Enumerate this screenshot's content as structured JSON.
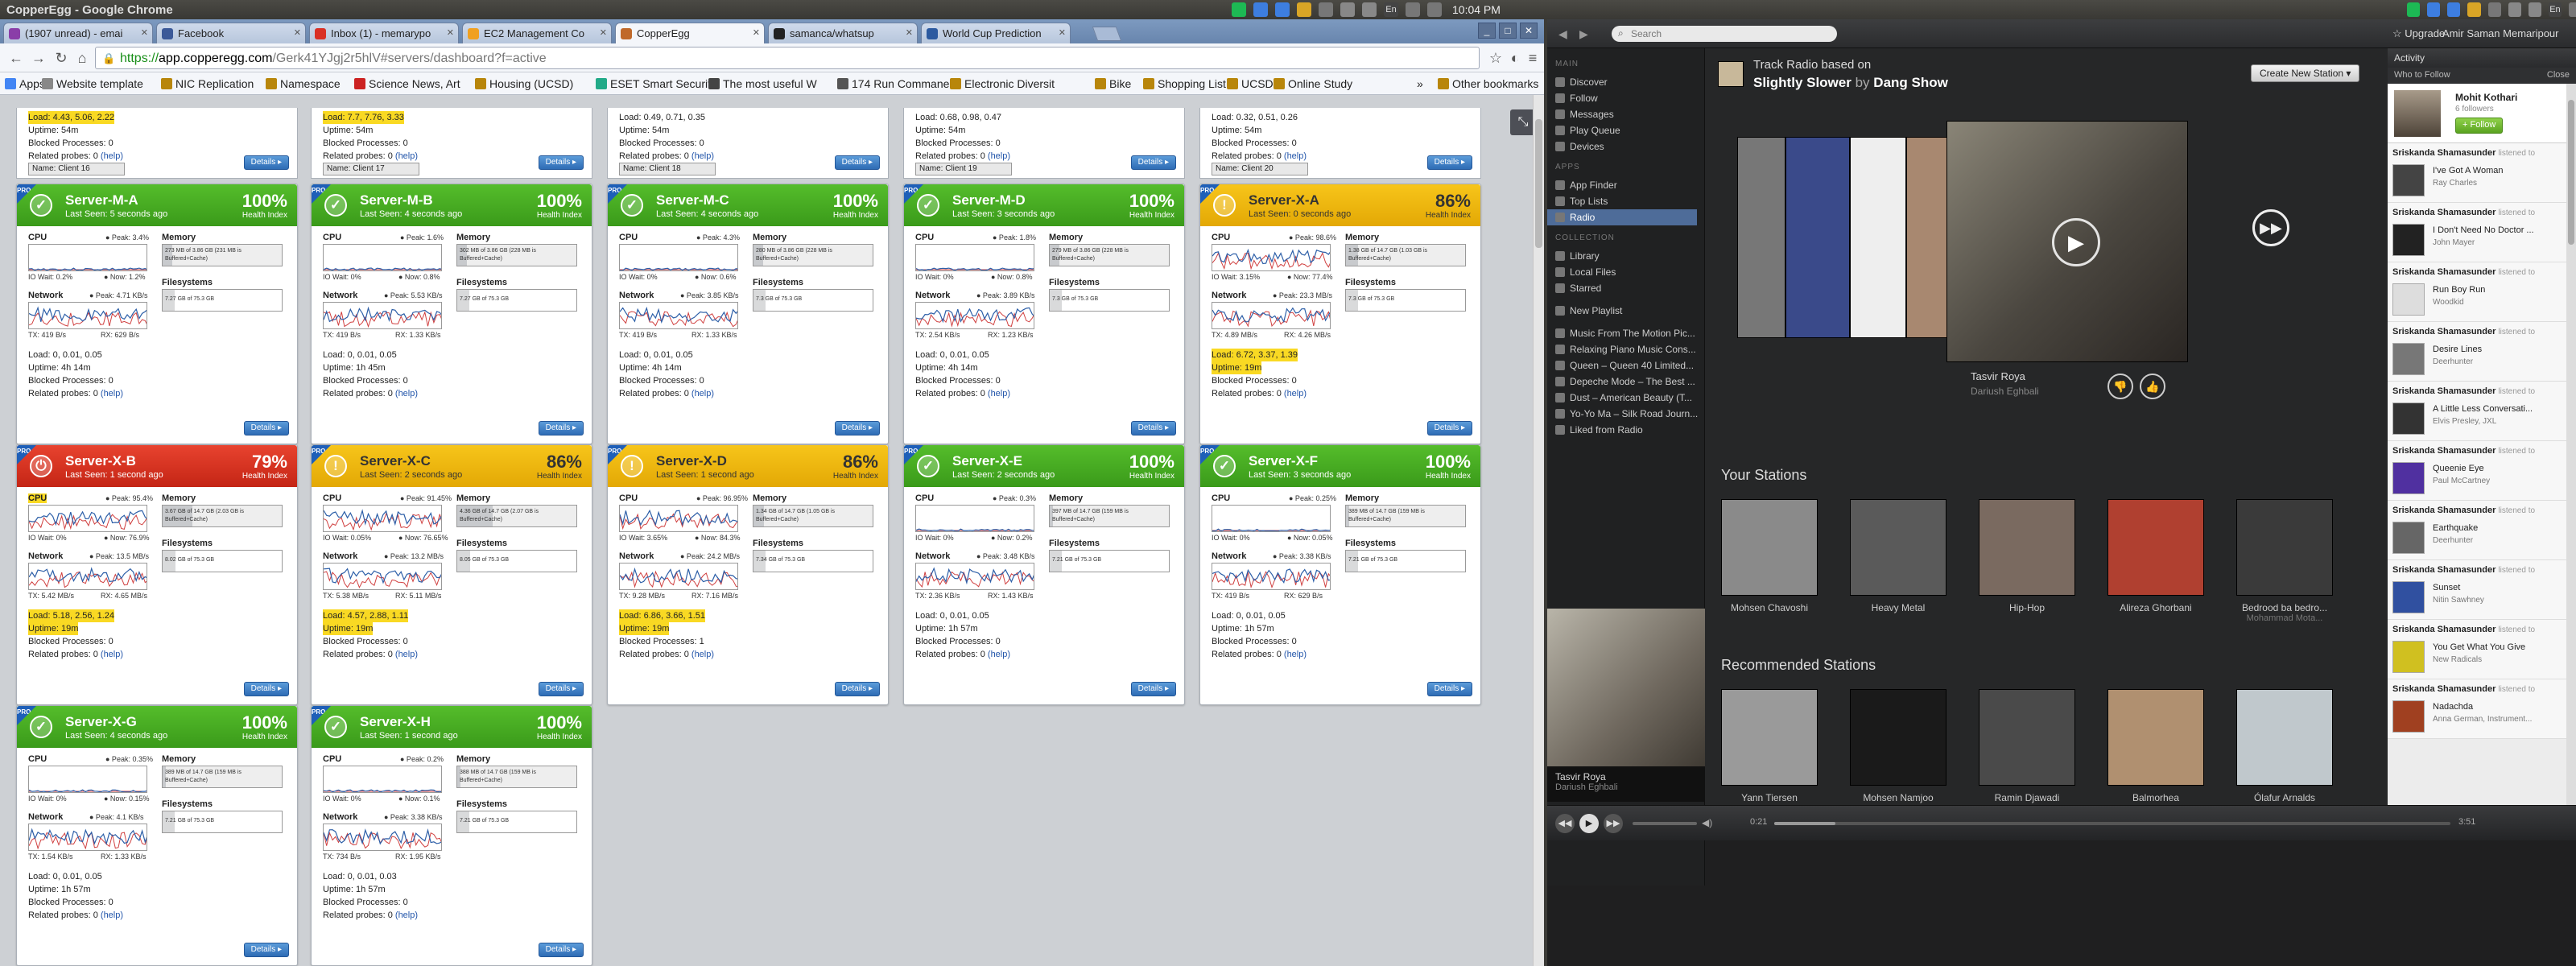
{
  "system": {
    "window_title": "CopperEgg - Google Chrome",
    "clock_left": "10:04 PM",
    "clock_right": "10:04 PM",
    "tray_left": [
      "spotify-icon",
      "dropbox-icon",
      "dropbox-icon",
      "chrome-icon",
      "network-icon",
      "mail-icon",
      "bluetooth-icon",
      "keyboard-en-icon",
      "battery-icon",
      "volume-icon"
    ],
    "tray_right": [
      "spotify-icon",
      "dropbox-icon",
      "dropbox-icon",
      "chrome-icon",
      "network-icon",
      "mail-icon",
      "bluetooth-icon",
      "keyboard-en-icon",
      "battery-icon",
      "volume-icon"
    ],
    "keyboard_label": "En"
  },
  "chrome": {
    "tabs": [
      {
        "label": "(1907 unread) - emai",
        "color": "#8a3ea8"
      },
      {
        "label": "Facebook",
        "color": "#3b5998"
      },
      {
        "label": "Inbox (1) - memarypo",
        "color": "#d93025"
      },
      {
        "label": "EC2 Management Co",
        "color": "#f0a020"
      },
      {
        "label": "CopperEgg",
        "color": "#c0692a"
      },
      {
        "label": "samanca/whatsup",
        "color": "#222222"
      },
      {
        "label": "World Cup Prediction",
        "color": "#2c5aa0"
      }
    ],
    "active_tab": 4,
    "url_scheme": "https",
    "url_host": "app.copperegg.com",
    "url_path": "/Gerk41YJgj2r5hlV#servers/dashboard?f=active",
    "bookmarks": [
      {
        "label": "Apps",
        "color": "#4285f4"
      },
      {
        "label": "Website template",
        "color": "#888888"
      },
      {
        "label": "NIC Replication",
        "color": "#b8860b"
      },
      {
        "label": "Namespace",
        "color": "#b8860b"
      },
      {
        "label": "Science News, Art",
        "color": "#cc2222"
      },
      {
        "label": "Housing (UCSD)",
        "color": "#b8860b"
      },
      {
        "label": "ESET Smart Securit",
        "color": "#22aa88"
      },
      {
        "label": "The most useful W",
        "color": "#444444"
      },
      {
        "label": "174 Run Commane",
        "color": "#555555"
      },
      {
        "label": "Electronic Diversit",
        "color": "#b8860b"
      },
      {
        "label": "Bike",
        "color": "#b8860b"
      },
      {
        "label": "Shopping List",
        "color": "#b8860b"
      },
      {
        "label": "UCSD",
        "color": "#b8860b"
      },
      {
        "label": "Online Study",
        "color": "#b8860b"
      },
      {
        "label": "Other bookmarks",
        "color": "#b8860b"
      }
    ],
    "bookmarks_more": "»"
  },
  "dashboard": {
    "partials": [
      {
        "load": "Load: 4.43, 5.06, 2.22",
        "warn": true,
        "uptime": "Uptime: 54m",
        "blocked": "Blocked Processes: 0",
        "related": "Related probes: 0",
        "help": "(help)",
        "tag": "Name: Client 16",
        "details": "Details ▸"
      },
      {
        "load": "Load: 7.7, 7.76, 3.33",
        "warn": true,
        "uptime": "Uptime: 54m",
        "blocked": "Blocked Processes: 0",
        "related": "Related probes: 0",
        "help": "(help)",
        "tag": "Name: Client 17",
        "details": "Details ▸"
      },
      {
        "load": "Load: 0.49, 0.71, 0.35",
        "warn": false,
        "uptime": "Uptime: 54m",
        "blocked": "Blocked Processes: 0",
        "related": "Related probes: 0",
        "help": "(help)",
        "tag": "Name: Client 18",
        "details": "Details ▸"
      },
      {
        "load": "Load: 0.68, 0.98, 0.47",
        "warn": false,
        "uptime": "Uptime: 54m",
        "blocked": "Blocked Processes: 0",
        "related": "Related probes: 0",
        "help": "(help)",
        "tag": "Name: Client 19",
        "details": "Details ▸"
      },
      {
        "load": "Load: 0.32, 0.51, 0.26",
        "warn": false,
        "uptime": "Uptime: 54m",
        "blocked": "Blocked Processes: 0",
        "related": "Related probes: 0",
        "help": "(help)",
        "tag": "Name: Client 20",
        "details": "Details ▸"
      }
    ],
    "labels": {
      "cpu": "CPU",
      "memory": "Memory",
      "network": "Network",
      "filesystems": "Filesystems",
      "health": "Health Index",
      "details": "Details ▸",
      "help": "(help)",
      "pro": "PRO"
    },
    "servers": [
      {
        "name": "Server-M-A",
        "status": "green",
        "seen": "Last Seen: 5 seconds ago",
        "health": "100%",
        "cpu_peak": "● Peak: 3.4%",
        "iowait": "IO Wait: 0.2%",
        "now": "● Now: 1.2%",
        "net_peak": "● Peak: 4.71 KB/s",
        "tx": "TX: 419 B/s",
        "rx": "RX: 629 B/s",
        "mem": "273 MB of 3.86 GB (231 MB is Buffered+Cache)",
        "mem_pct": 0.08,
        "fs": "7.27 GB of 75.3 GB",
        "fs_pct": 0.1,
        "load": "Load: 0, 0.01, 0.05",
        "load_warn": false,
        "uptime": "Uptime: 4h 14m",
        "uptime_warn": false,
        "blocked": "Blocked Processes: 0",
        "related": "Related probes: 0",
        "cpu_spiky": false,
        "net_spiky": true
      },
      {
        "name": "Server-M-B",
        "status": "green",
        "seen": "Last Seen: 4 seconds ago",
        "health": "100%",
        "cpu_peak": "● Peak: 1.6%",
        "iowait": "IO Wait: 0%",
        "now": "● Now: 0.8%",
        "net_peak": "● Peak: 5.53 KB/s",
        "tx": "TX: 419 B/s",
        "rx": "RX: 1.33 KB/s",
        "mem": "302 MB of 3.86 GB (228 MB is Buffered+Cache)",
        "mem_pct": 0.08,
        "fs": "7.27 GB of 75.3 GB",
        "fs_pct": 0.1,
        "load": "Load: 0, 0.01, 0.05",
        "load_warn": false,
        "uptime": "Uptime: 1h 45m",
        "uptime_warn": false,
        "blocked": "Blocked Processes: 0",
        "related": "Related probes: 0",
        "cpu_spiky": false,
        "net_spiky": true
      },
      {
        "name": "Server-M-C",
        "status": "green",
        "seen": "Last Seen: 4 seconds ago",
        "health": "100%",
        "cpu_peak": "● Peak: 4.3%",
        "iowait": "IO Wait: 0%",
        "now": "● Now: 0.6%",
        "net_peak": "● Peak: 3.85 KB/s",
        "tx": "TX: 419 B/s",
        "rx": "RX: 1.33 KB/s",
        "mem": "280 MB of 3.86 GB (228 MB is Buffered+Cache)",
        "mem_pct": 0.08,
        "fs": "7.3 GB of 75.3 GB",
        "fs_pct": 0.1,
        "load": "Load: 0, 0.01, 0.05",
        "load_warn": false,
        "uptime": "Uptime: 4h 14m",
        "uptime_warn": false,
        "blocked": "Blocked Processes: 0",
        "related": "Related probes: 0",
        "cpu_spiky": false,
        "net_spiky": true
      },
      {
        "name": "Server-M-D",
        "status": "green",
        "seen": "Last Seen: 3 seconds ago",
        "health": "100%",
        "cpu_peak": "● Peak: 1.8%",
        "iowait": "IO Wait: 0%",
        "now": "● Now: 0.8%",
        "net_peak": "● Peak: 3.89 KB/s",
        "tx": "TX: 2.54 KB/s",
        "rx": "RX: 1.23 KB/s",
        "mem": "279 MB of 3.86 GB (228 MB is Buffered+Cache)",
        "mem_pct": 0.08,
        "fs": "7.3 GB of 75.3 GB",
        "fs_pct": 0.1,
        "load": "Load: 0, 0.01, 0.05",
        "load_warn": false,
        "uptime": "Uptime: 4h 14m",
        "uptime_warn": false,
        "blocked": "Blocked Processes: 0",
        "related": "Related probes: 0",
        "cpu_spiky": false,
        "net_spiky": true
      },
      {
        "name": "Server-X-A",
        "status": "yellow",
        "seen": "Last Seen: 0 seconds ago",
        "health": "86%",
        "cpu_peak": "● Peak: 98.6%",
        "iowait": "IO Wait: 3.15%",
        "now": "● Now: 77.4%",
        "net_peak": "● Peak: 23.3 MB/s",
        "tx": "TX: 4.89 MB/s",
        "rx": "RX: 4.26 MB/s",
        "mem": "1.38 GB of 14.7 GB (1.03 GB is Buffered+Cache)",
        "mem_pct": 0.1,
        "fs": "7.3 GB of 75.3 GB",
        "fs_pct": 0.1,
        "load": "Load: 6.72, 3.37, 1.39",
        "load_warn": true,
        "uptime": "Uptime: 19m",
        "uptime_warn": true,
        "blocked": "Blocked Processes: 0",
        "related": "Related probes: 0",
        "cpu_spiky": true,
        "net_spiky": true
      },
      {
        "name": "Server-X-B",
        "status": "red",
        "seen": "Last Seen: 1 second ago",
        "health": "79%",
        "cpu_peak": "● Peak: 95.4%",
        "iowait": "IO Wait: 0%",
        "now": "● Now: 76.9%",
        "net_peak": "● Peak: 13.5 MB/s",
        "tx": "TX: 5.42 MB/s",
        "rx": "RX: 4.65 MB/s",
        "mem": "3.67 GB of 14.7 GB (2.03 GB is Buffered+Cache)",
        "mem_pct": 0.25,
        "fs": "8.02 GB of 75.3 GB",
        "fs_pct": 0.11,
        "load": "Load: 5.18, 2.56, 1.24",
        "load_warn": true,
        "uptime": "Uptime: 19m",
        "uptime_warn": true,
        "blocked": "Blocked Processes: 0",
        "related": "Related probes: 0",
        "cpu_spiky": true,
        "net_spiky": true
      },
      {
        "name": "Server-X-C",
        "status": "yellow",
        "seen": "Last Seen: 2 seconds ago",
        "health": "86%",
        "cpu_peak": "● Peak: 91.45%",
        "iowait": "IO Wait: 0.05%",
        "now": "● Now: 76.65%",
        "net_peak": "● Peak: 13.2 MB/s",
        "tx": "TX: 5.38 MB/s",
        "rx": "RX: 5.11 MB/s",
        "mem": "4.36 GB of 14.7 GB (2.07 GB is Buffered+Cache)",
        "mem_pct": 0.3,
        "fs": "8.05 GB of 75.3 GB",
        "fs_pct": 0.11,
        "load": "Load: 4.57, 2.88, 1.11",
        "load_warn": true,
        "uptime": "Uptime: 19m",
        "uptime_warn": true,
        "blocked": "Blocked Processes: 0",
        "related": "Related probes: 0",
        "cpu_spiky": true,
        "net_spiky": true
      },
      {
        "name": "Server-X-D",
        "status": "yellow",
        "seen": "Last Seen: 1 second ago",
        "health": "86%",
        "cpu_peak": "● Peak: 96.95%",
        "iowait": "IO Wait: 3.65%",
        "now": "● Now: 84.3%",
        "net_peak": "● Peak: 24.2 MB/s",
        "tx": "TX: 9.28 MB/s",
        "rx": "RX: 7.16 MB/s",
        "mem": "1.34 GB of 14.7 GB (1.05 GB is Buffered+Cache)",
        "mem_pct": 0.09,
        "fs": "7.34 GB of 75.3 GB",
        "fs_pct": 0.1,
        "load": "Load: 6.86, 3.66, 1.51",
        "load_warn": true,
        "uptime": "Uptime: 19m",
        "uptime_warn": true,
        "blocked": "Blocked Processes: 1",
        "related": "Related probes: 0",
        "cpu_spiky": true,
        "net_spiky": true
      },
      {
        "name": "Server-X-E",
        "status": "green",
        "seen": "Last Seen: 2 seconds ago",
        "health": "100%",
        "cpu_peak": "● Peak: 0.3%",
        "iowait": "IO Wait: 0%",
        "now": "● Now: 0.2%",
        "net_peak": "● Peak: 3.48 KB/s",
        "tx": "TX: 2.36 KB/s",
        "rx": "RX: 1.43 KB/s",
        "mem": "397 MB of 14.7 GB (159 MB is Buffered+Cache)",
        "mem_pct": 0.03,
        "fs": "7.21 GB of 75.3 GB",
        "fs_pct": 0.1,
        "load": "Load: 0, 0.01, 0.05",
        "load_warn": false,
        "uptime": "Uptime: 1h 57m",
        "uptime_warn": false,
        "blocked": "Blocked Processes: 0",
        "related": "Related probes: 0",
        "cpu_spiky": false,
        "net_spiky": true
      },
      {
        "name": "Server-X-F",
        "status": "green",
        "seen": "Last Seen: 3 seconds ago",
        "health": "100%",
        "cpu_peak": "● Peak: 0.25%",
        "iowait": "IO Wait: 0%",
        "now": "● Now: 0.05%",
        "net_peak": "● Peak: 3.38 KB/s",
        "tx": "TX: 419 B/s",
        "rx": "RX: 629 B/s",
        "mem": "389 MB of 14.7 GB (159 MB is Buffered+Cache)",
        "mem_pct": 0.03,
        "fs": "7.21 GB of 75.3 GB",
        "fs_pct": 0.1,
        "load": "Load: 0, 0.01, 0.05",
        "load_warn": false,
        "uptime": "Uptime: 1h 57m",
        "uptime_warn": false,
        "blocked": "Blocked Processes: 0",
        "related": "Related probes: 0",
        "cpu_spiky": false,
        "net_spiky": true
      },
      {
        "name": "Server-X-G",
        "status": "green",
        "seen": "Last Seen: 4 seconds ago",
        "health": "100%",
        "cpu_peak": "● Peak: 0.35%",
        "iowait": "IO Wait: 0%",
        "now": "● Now: 0.15%",
        "net_peak": "● Peak: 4.1 KB/s",
        "tx": "TX: 1.54 KB/s",
        "rx": "RX: 1.33 KB/s",
        "mem": "389 MB of 14.7 GB (159 MB is Buffered+Cache)",
        "mem_pct": 0.03,
        "fs": "7.21 GB of 75.3 GB",
        "fs_pct": 0.1,
        "load": "Load: 0, 0.01, 0.05",
        "load_warn": false,
        "uptime": "Uptime: 1h 57m",
        "uptime_warn": false,
        "blocked": "Blocked Processes: 0",
        "related": "Related probes: 0",
        "cpu_spiky": false,
        "net_spiky": true
      },
      {
        "name": "Server-X-H",
        "status": "green",
        "seen": "Last Seen: 1 second ago",
        "health": "100%",
        "cpu_peak": "● Peak: 0.2%",
        "iowait": "IO Wait: 0%",
        "now": "● Now: 0.1%",
        "net_peak": "● Peak: 3.38 KB/s",
        "tx": "TX: 734 B/s",
        "rx": "RX: 1.95 KB/s",
        "mem": "388 MB of 14.7 GB (159 MB is Buffered+Cache)",
        "mem_pct": 0.03,
        "fs": "7.21 GB of 75.3 GB",
        "fs_pct": 0.1,
        "load": "Load: 0, 0.01, 0.03",
        "load_warn": false,
        "uptime": "Uptime: 1h 57m",
        "uptime_warn": false,
        "blocked": "Blocked Processes: 0",
        "related": "Related probes: 0",
        "cpu_spiky": false,
        "net_spiky": true
      }
    ]
  },
  "spotify": {
    "search_placeholder": "Search",
    "upgrade": "Upgrade",
    "user": "Amir Saman Memaripour",
    "sidebar": {
      "main_header": "MAIN",
      "main": [
        "Discover",
        "Follow",
        "Messages",
        "Play Queue",
        "Devices"
      ],
      "apps_header": "APPS",
      "apps": [
        "App Finder",
        "Top Lists",
        "Radio"
      ],
      "collection_header": "COLLECTION",
      "collection": [
        "Library",
        "Local Files",
        "Starred"
      ],
      "new_playlist": "New Playlist",
      "playlists": [
        "Music From The Motion Pic...",
        "Relaxing Piano Music Cons...",
        "Queen – Queen 40 Limited...",
        "Depeche Mode – The Best ...",
        "Dust – American Beauty (T...",
        "Yo-Yo Ma – Silk Road Journ...",
        "Liked from Radio"
      ]
    },
    "now_playing": {
      "title": "Tasvir Roya",
      "artist": "Dariush Eghbali"
    },
    "radio": {
      "header": "Track Radio based on",
      "track": "Slightly Slower",
      "by": "by",
      "artist": "Dang Show",
      "new_station": "Create New Station ▾",
      "current_title": "Tasvir Roya",
      "current_artist": "Dariush Eghbali"
    },
    "your_stations_title": "Your Stations",
    "your_stations": [
      {
        "name": "Mohsen Chavoshi",
        "sub": "",
        "color": "#8a8a8a"
      },
      {
        "name": "Heavy Metal",
        "sub": "",
        "color": "#5a5a5a"
      },
      {
        "name": "Hip-Hop",
        "sub": "",
        "color": "#7a6a60"
      },
      {
        "name": "Alireza Ghorbani",
        "sub": "",
        "color": "#b04030"
      },
      {
        "name": "Bedrood ba bedro...",
        "sub": "Mohammad Mota...",
        "color": "#3a3a3a"
      }
    ],
    "recommended_title": "Recommended Stations",
    "recommended": [
      {
        "name": "Yann Tiersen",
        "color": "#9a9a9a"
      },
      {
        "name": "Mohsen Namjoo",
        "color": "#1a1a1a"
      },
      {
        "name": "Ramin Djawadi",
        "color": "#4a4a4a"
      },
      {
        "name": "Balmorhea",
        "color": "#b09070"
      },
      {
        "name": "Ólafur Arnalds",
        "color": "#c0c8cc"
      }
    ],
    "player": {
      "elapsed": "0:21",
      "total": "3:51",
      "progress": 0.09
    },
    "activity": {
      "title": "Activity",
      "who_to_follow": "Who to Follow",
      "close": "Close",
      "suggest_name": "Mohit Kothari",
      "suggest_followers": "6 followers",
      "follow_btn": "+ Follow",
      "listened": "listened to",
      "feed": [
        {
          "who": "Sriskanda Shamasunder",
          "title": "I've Got A Woman",
          "artist": "Ray Charles",
          "color": "#444"
        },
        {
          "who": "Sriskanda Shamasunder",
          "title": "I Don't Need No Doctor ...",
          "artist": "John Mayer",
          "color": "#222"
        },
        {
          "who": "Sriskanda Shamasunder",
          "title": "Run Boy Run",
          "artist": "Woodkid",
          "color": "#ddd"
        },
        {
          "who": "Sriskanda Shamasunder",
          "title": "Desire Lines",
          "artist": "Deerhunter",
          "color": "#777"
        },
        {
          "who": "Sriskanda Shamasunder",
          "title": "A Little Less Conversati...",
          "artist": "Elvis Presley, JXL",
          "color": "#333"
        },
        {
          "who": "Sriskanda Shamasunder",
          "title": "Queenie Eye",
          "artist": "Paul McCartney",
          "color": "#5030a0"
        },
        {
          "who": "Sriskanda Shamasunder",
          "title": "Earthquake",
          "artist": "Deerhunter",
          "color": "#666"
        },
        {
          "who": "Sriskanda Shamasunder",
          "title": "Sunset",
          "artist": "Nitin Sawhney",
          "color": "#3050a0"
        },
        {
          "who": "Sriskanda Shamasunder",
          "title": "You Get What You Give",
          "artist": "New Radicals",
          "color": "#d0c020"
        },
        {
          "who": "Sriskanda Shamasunder",
          "title": "Nadachda",
          "artist": "Anna German, Instrument...",
          "color": "#a04020"
        }
      ]
    }
  }
}
